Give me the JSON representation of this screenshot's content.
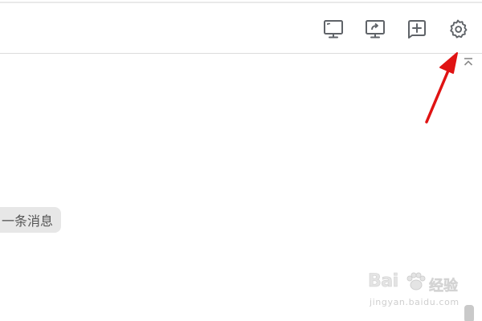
{
  "toolbar": {
    "buttons": [
      {
        "id": "screen-share",
        "icon": "monitor-icon"
      },
      {
        "id": "screen-cast",
        "icon": "monitor-share-icon"
      },
      {
        "id": "add-window",
        "icon": "add-window-icon"
      },
      {
        "id": "settings",
        "icon": "gear-icon"
      }
    ],
    "collapse_icon": "collapse-up-icon"
  },
  "chat": {
    "message_pill": "一条消息"
  },
  "annotation": {
    "arrow_color": "#e01313"
  },
  "watermark": {
    "brand": "Bai",
    "brand_cn": "经验",
    "url": "jingyan.baidu.com"
  },
  "colors": {
    "icon": "#5f6368",
    "pill_bg": "#e7e7e7",
    "divider": "#dcdcdc"
  }
}
